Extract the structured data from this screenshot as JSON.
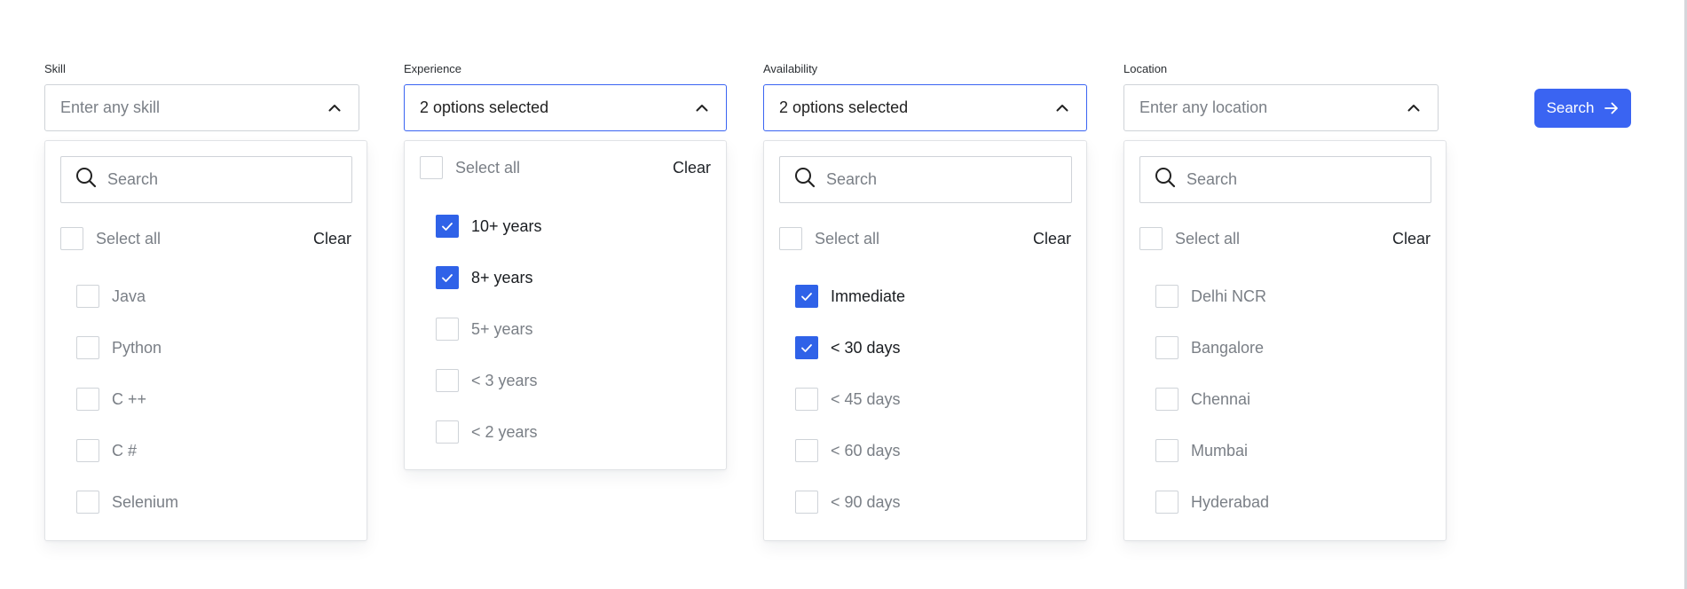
{
  "colors": {
    "accent": "#3a64f2",
    "checkbox_checked": "#2f62e8",
    "muted_text": "#7a7f86",
    "border": "#cfd3d8"
  },
  "filters": {
    "skill": {
      "label": "Skill",
      "placeholder": "Enter any skill",
      "search_placeholder": "Search",
      "select_all": "Select all",
      "clear": "Clear",
      "options": [
        {
          "label": "Java",
          "checked": false
        },
        {
          "label": "Python",
          "checked": false
        },
        {
          "label": "C ++",
          "checked": false
        },
        {
          "label": "C #",
          "checked": false
        },
        {
          "label": "Selenium",
          "checked": false
        }
      ]
    },
    "experience": {
      "label": "Experience",
      "value": "2 options selected",
      "select_all": "Select all",
      "clear": "Clear",
      "options": [
        {
          "label": "10+ years",
          "checked": true
        },
        {
          "label": "8+ years",
          "checked": true
        },
        {
          "label": "5+ years",
          "checked": false
        },
        {
          "label": "< 3 years",
          "checked": false
        },
        {
          "label": "< 2 years",
          "checked": false
        }
      ]
    },
    "availability": {
      "label": "Availability",
      "value": "2 options selected",
      "search_placeholder": "Search",
      "select_all": "Select all",
      "clear": "Clear",
      "options": [
        {
          "label": "Immediate",
          "checked": true
        },
        {
          "label": "< 30 days",
          "checked": true
        },
        {
          "label": "< 45 days",
          "checked": false
        },
        {
          "label": "< 60 days",
          "checked": false
        },
        {
          "label": "< 90 days",
          "checked": false
        }
      ]
    },
    "location": {
      "label": "Location",
      "placeholder": "Enter any location",
      "search_placeholder": "Search",
      "select_all": "Select all",
      "clear": "Clear",
      "options": [
        {
          "label": "Delhi NCR",
          "checked": false
        },
        {
          "label": "Bangalore",
          "checked": false
        },
        {
          "label": "Chennai",
          "checked": false
        },
        {
          "label": "Mumbai",
          "checked": false
        },
        {
          "label": "Hyderabad",
          "checked": false
        }
      ]
    }
  },
  "search_button": {
    "label": "Search",
    "icon": "arrow-right-icon"
  }
}
